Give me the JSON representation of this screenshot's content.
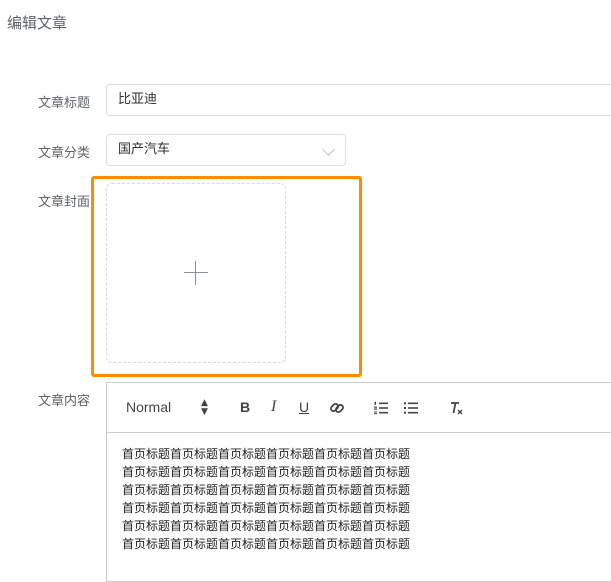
{
  "page": {
    "title": "编辑文章"
  },
  "form": {
    "title_label": "文章标题",
    "title_value": "比亚迪",
    "category_label": "文章分类",
    "category_value": "国产汽车",
    "cover_label": "文章封面",
    "content_label": "文章内容"
  },
  "editor": {
    "toolbar": {
      "format_label": "Normal",
      "bold_label": "B",
      "italic_label": "I",
      "underline_label": "U"
    },
    "content_lines": [
      "首页标题首页标题首页标题首页标题首页标题首页标题",
      "首页标题首页标题首页标题首页标题首页标题首页标题",
      "首页标题首页标题首页标题首页标题首页标题首页标题",
      "首页标题首页标题首页标题首页标题首页标题首页标题",
      "首页标题首页标题首页标题首页标题首页标题首页标题",
      "首页标题首页标题首页标题首页标题首页标题首页标题"
    ]
  },
  "icons": {
    "upload": "plus-icon",
    "format_arrows": "up-down-arrows-icon",
    "link": "link-icon",
    "ordered_list": "ordered-list-icon",
    "bullet_list": "bullet-list-icon",
    "clear_format": "clear-format-icon",
    "select_arrow": "chevron-down-icon"
  },
  "colors": {
    "highlight": "#ff8c00",
    "border": "#dcdfe6",
    "label": "#606266"
  }
}
